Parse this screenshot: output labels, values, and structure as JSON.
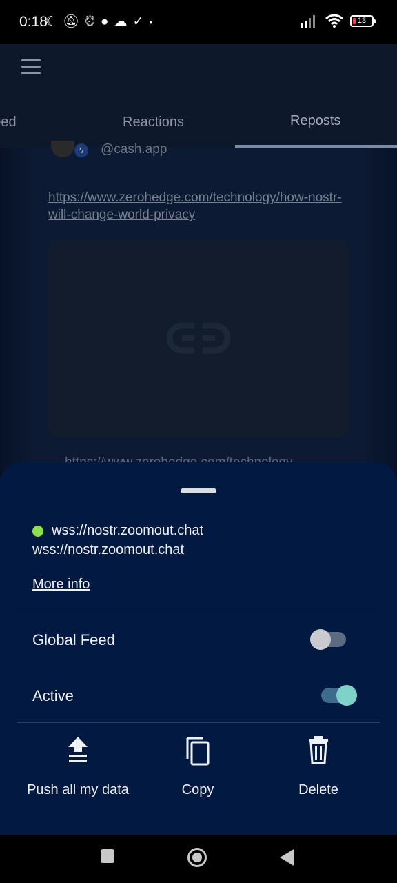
{
  "status_bar": {
    "time": "0:18",
    "icons": [
      "moon-icon",
      "alarm-off-icon",
      "alarm-icon",
      "chat-icon",
      "cloud-icon",
      "check-icon",
      "dot-icon"
    ],
    "battery_level": "13"
  },
  "header": {
    "tabs": [
      {
        "label": "Feed"
      },
      {
        "label": "Reactions"
      },
      {
        "label": "Reposts"
      }
    ],
    "active_tab": "Reposts"
  },
  "feed": {
    "handle": "@cash.app",
    "link": "https://www.zerohedge.com/technology/how-nostr-will-change-world-privacy",
    "link_preview_partial": "https://www.zerohedge.com/technology"
  },
  "sheet": {
    "relay_url": "wss://nostr.zoomout.chat",
    "relay_subtitle": "wss://nostr.zoomout.chat",
    "status_color": "#8ee04a",
    "more_info": "More info",
    "settings": [
      {
        "label": "Global Feed",
        "enabled": false
      },
      {
        "label": "Active",
        "enabled": true
      }
    ],
    "actions": [
      {
        "label": "Push all my data",
        "icon": "upload-icon"
      },
      {
        "label": "Copy",
        "icon": "copy-icon"
      },
      {
        "label": "Delete",
        "icon": "trash-icon"
      }
    ]
  },
  "colors": {
    "sheet_background": "#021a42",
    "switch_on_knob": "#7ed3c8",
    "switch_off_knob": "#c8cacf"
  }
}
